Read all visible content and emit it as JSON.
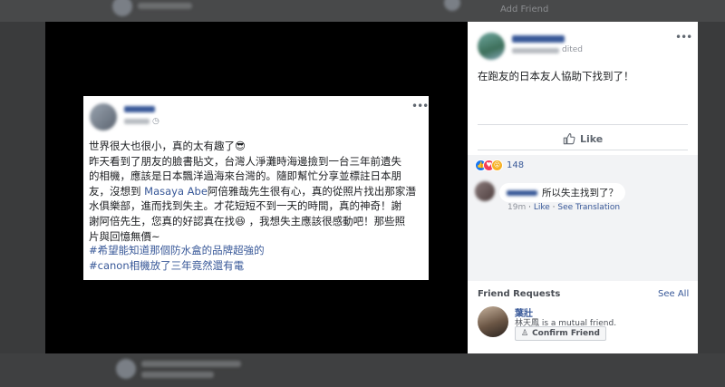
{
  "background": {
    "top_link": "Add Friend"
  },
  "photo_post": {
    "body_lines": [
      "世界很大也很小，真的太有趣了😎",
      "昨天看到了朋友的臉書貼文，台灣人淨灘時海邊撿到一台三年前遺失",
      "的相機，應該是日本飄洋過海來台灣的。隨即幫忙分享並標註日本朋",
      "友，沒想到",
      "阿倍雅哉先生很有心，真的從照片找出那家潛",
      "水俱樂部，進而找到失主。才花短短不到一天的時間，真的神奇！謝",
      "謝阿倍先生，您真的好認真在找😆 ，我想失主應該很感動吧！那些照",
      "片與回憶無價~"
    ],
    "mention": "Masaya Abe",
    "hashtags": [
      "#希望能知道那個防水盒的品牌超強的",
      "#canon相機放了三年竟然還有電"
    ]
  },
  "panel": {
    "edited_label": "dited",
    "caption": "在跑友的日本友人協助下找到了！",
    "like_label": "Like",
    "reaction_count": "148",
    "comment": {
      "text": "所以失主找到了？",
      "time": "19m",
      "like_link": "Like",
      "translation_link": "See Translation"
    },
    "friend_requests": {
      "title": "Friend Requests",
      "see_all": "See All",
      "name": "葉壯",
      "mutual": "林天鳳 is a mutual friend.",
      "confirm_label": "Confirm Friend"
    }
  }
}
